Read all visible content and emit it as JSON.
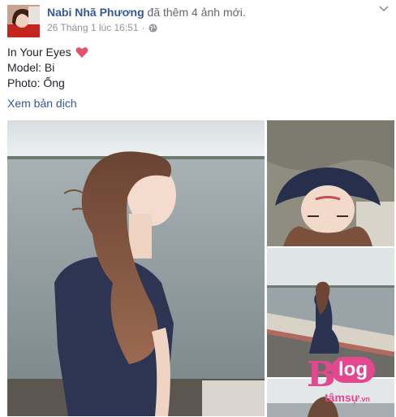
{
  "post": {
    "author": {
      "name": "Nabi Nhã Phương",
      "action": "đã thêm 4 ảnh mới."
    },
    "timestamp": "26 Tháng 1 lúc 16:51",
    "timestamp_separator": "·",
    "caption": {
      "line1": "In Your Eyes",
      "line2": "Model: Bi",
      "line3": "Photo: Ống"
    },
    "see_translation": "Xem bản dịch",
    "photos": [
      {
        "subject": "girl with long brown hair in navy dress by the water"
      },
      {
        "subject": "girl lying upside down on concrete"
      },
      {
        "subject": "girl standing on a seawall by the river"
      },
      {
        "subject": "partial photo"
      }
    ]
  },
  "watermark": {
    "letter": "B",
    "word": "log",
    "sub": "tâmsự",
    "domain": ".vn"
  },
  "icons": {
    "privacy": "globe-icon",
    "options": "chevron-down-icon",
    "emoji": "heart-icon"
  },
  "colors": {
    "link": "#365899",
    "meta": "#90949c",
    "heart": "#e2526e",
    "watermark": "#e2478f"
  }
}
